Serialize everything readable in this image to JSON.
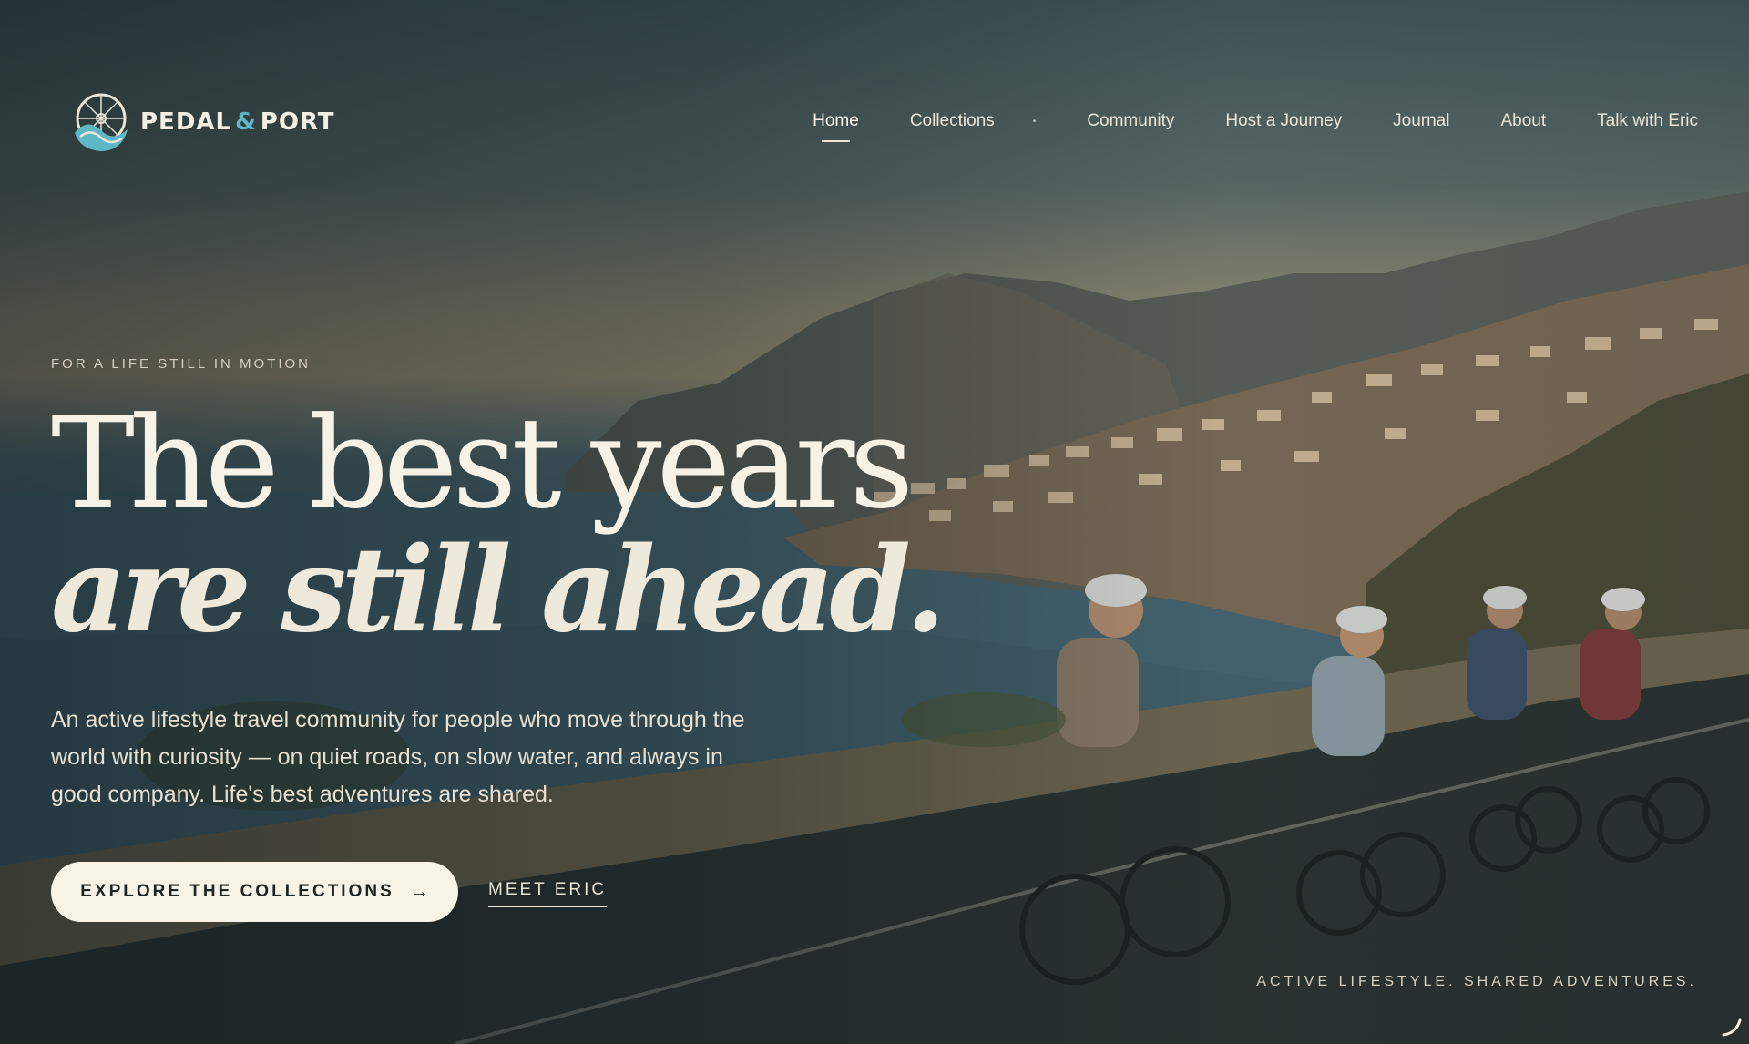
{
  "brand": {
    "name_left": "PEDAL",
    "amp": "&",
    "name_right": "PORT",
    "logo_icon": "wheel-wave-logo"
  },
  "nav": {
    "items": [
      {
        "label": "Home",
        "active": true
      },
      {
        "label": "Collections",
        "has_dropdown": true
      },
      {
        "label": "Community"
      },
      {
        "label": "Host a Journey"
      },
      {
        "label": "Journal"
      },
      {
        "label": "About"
      },
      {
        "label": "Talk with Eric"
      }
    ],
    "dropdown_dot": "•"
  },
  "hero": {
    "eyebrow": "FOR A LIFE STILL IN MOTION",
    "headline_line1": "The best years",
    "headline_line2": "are still ahead.",
    "lead": "An active lifestyle travel community for people who move through the world with curiosity — on quiet roads, on slow water, and always in good company. Life's best adventures are shared.",
    "cta_label": "EXPLORE THE COLLECTIONS",
    "cta_arrow": "→",
    "secondary_label": "MEET ERIC",
    "tagline": "ACTIVE LIFESTYLE. SHARED ADVENTURES."
  },
  "colors": {
    "accent": "#5fb6c4",
    "cream": "#f8f3e7",
    "dark": "#1c2624"
  }
}
